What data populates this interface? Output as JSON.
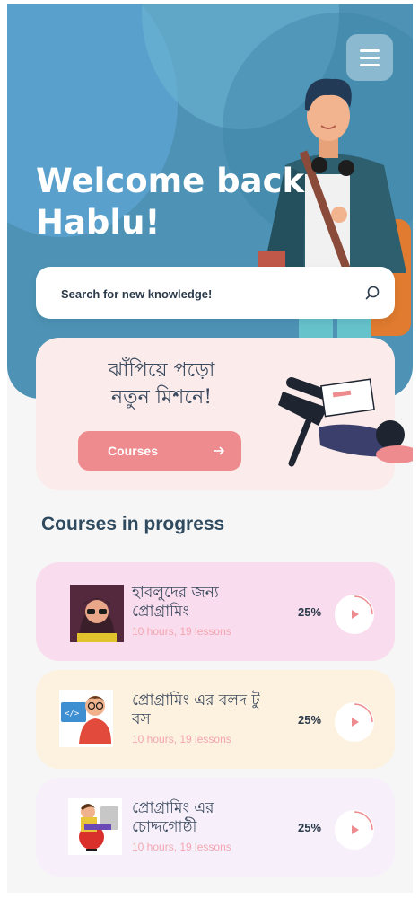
{
  "header": {
    "welcome_line1": "Welcome back",
    "welcome_line2": "Hablu!"
  },
  "search": {
    "placeholder": "Search for new knowledge!"
  },
  "mission": {
    "title_line1": "ঝাঁপিয়ে পড়ো",
    "title_line2": "নতুন মিশনে!",
    "button_label": "Courses"
  },
  "progress_section": {
    "title": "Courses in progress",
    "courses": [
      {
        "title": "হাবলুদের জন্য প্রোগ্রামিং",
        "meta": "10 hours, 19 lessons",
        "progress": "25%",
        "progress_fraction": 0.25,
        "bg": "#f9dced"
      },
      {
        "title": "প্রোগ্রামিং এর বলদ টু বস",
        "meta": "10 hours, 19 lessons",
        "progress": "25%",
        "progress_fraction": 0.25,
        "bg": "#fdf1df"
      },
      {
        "title": "প্রোগ্রামিং এর চোদ্দগোষ্ঠী",
        "meta": "10 hours, 19 lessons",
        "progress": "25%",
        "progress_fraction": 0.25,
        "bg": "#f7f0fb"
      }
    ]
  },
  "colors": {
    "hero": "#4e93b5",
    "accent": "#ee8b8e",
    "text_dark": "#2f4a5e",
    "meta_text": "#f3a6b0"
  },
  "icons": [
    "menu-icon",
    "search-icon",
    "arrow-right-icon",
    "play-icon"
  ]
}
